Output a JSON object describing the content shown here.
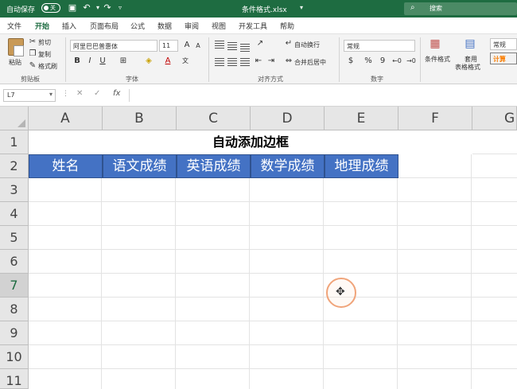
{
  "titlebar": {
    "autosave_label": "自动保存",
    "autosave_state": "关",
    "filename": "条件格式.xlsx",
    "search_placeholder": "搜索",
    "accent": "#1e6c41"
  },
  "tabs": [
    "文件",
    "开始",
    "插入",
    "页面布局",
    "公式",
    "数据",
    "审阅",
    "视图",
    "开发工具",
    "帮助"
  ],
  "active_tab": "开始",
  "ribbon": {
    "paste": "粘贴",
    "cut": "剪切",
    "copy": "复制",
    "format_painter": "格式刷",
    "clipboard_group": "剪贴板",
    "font_name": "阿里巴巴普惠体",
    "font_size": "11",
    "font_group": "字体",
    "wrap_text": "自动换行",
    "merge_center": "合并后居中",
    "alignment_group": "对齐方式",
    "number_format": "常规",
    "number_group": "数字",
    "conditional_format": "条件格式",
    "table_format_1": "套用",
    "table_format_2": "表格格式",
    "style_normal": "常规",
    "style_calc": "计算"
  },
  "formula_bar": {
    "name_box": "L7",
    "fx": "fx",
    "content": ""
  },
  "columns": [
    "A",
    "B",
    "C",
    "D",
    "E",
    "F",
    "G"
  ],
  "rows": [
    "1",
    "2",
    "3",
    "4",
    "5",
    "6",
    "7",
    "8",
    "9",
    "10",
    "11"
  ],
  "selected_row": "7",
  "sheet": {
    "title": "自动添加边框",
    "headers": [
      "姓名",
      "语文成绩",
      "英语成绩",
      "数学成绩",
      "地理成绩"
    ],
    "header_fill": "#4472c4"
  }
}
